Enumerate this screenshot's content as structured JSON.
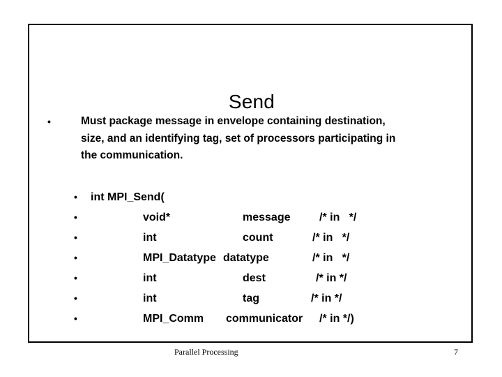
{
  "slide": {
    "title": "Send",
    "bullet_marker": "•",
    "paragraph": {
      "lines": [
        "Must package message in envelope containing destination,",
        "size, and an identifying tag, set of processors participating in",
        "the communication."
      ]
    },
    "code": {
      "signature_line": "int MPI_Send(",
      "params": [
        {
          "type": "void*",
          "name": "message",
          "comment": "/* in   */"
        },
        {
          "type": "int",
          "name": "count",
          "comment": "/* in   */"
        },
        {
          "type": "MPI_Datatype",
          "name": "datatype",
          "comment": "/* in   */"
        },
        {
          "type": "int",
          "name": "dest",
          "comment": "/* in */"
        },
        {
          "type": "int",
          "name": "tag",
          "comment": "/* in */"
        },
        {
          "type": "MPI_Comm",
          "name": "communicator",
          "comment": "/* in */)"
        }
      ]
    }
  },
  "footer": {
    "note": "Parallel Processing",
    "page_number": "7"
  },
  "colors": {
    "text": "#000000",
    "background": "#ffffff",
    "border": "#000000"
  }
}
